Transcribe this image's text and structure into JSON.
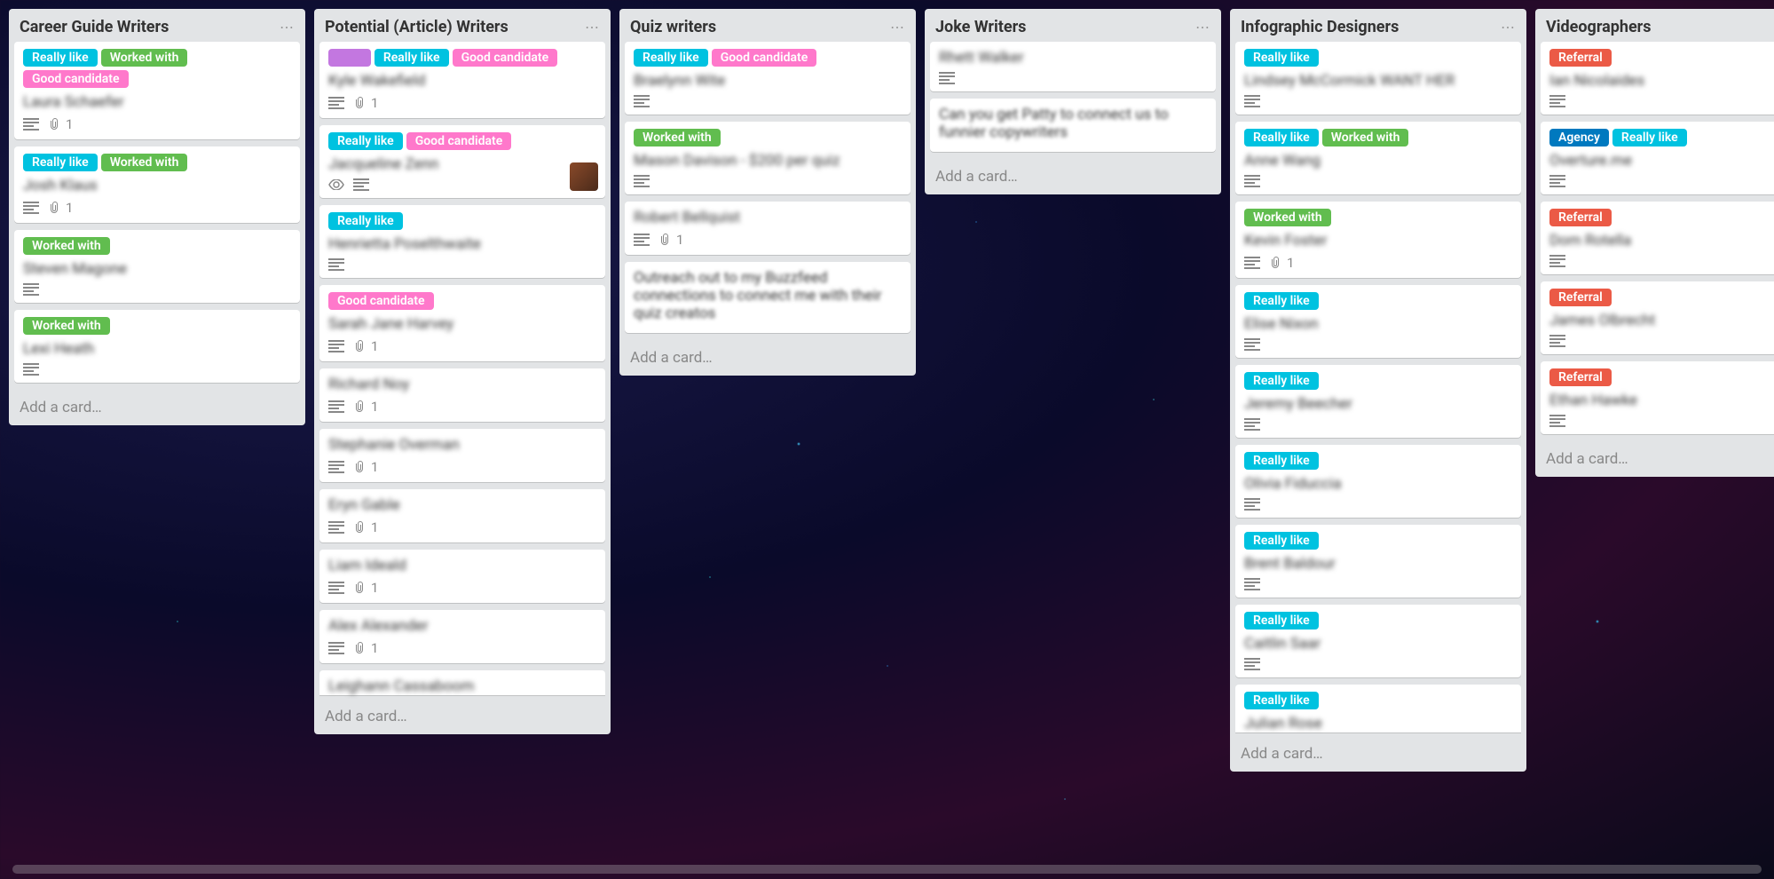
{
  "labels": {
    "really_like": "Really like",
    "worked_with": "Worked with",
    "good_candidate": "Good candidate",
    "referral": "Referral",
    "agency": "Agency"
  },
  "add_card": "Add a card…",
  "lists": [
    {
      "title": "Career Guide Writers",
      "cards": [
        {
          "labels": [
            [
              "cyan",
              "really_like"
            ],
            [
              "green",
              "worked_with"
            ],
            [
              "pink",
              "good_candidate"
            ]
          ],
          "title": "Laura Schaefer",
          "desc": true,
          "attach": "1"
        },
        {
          "labels": [
            [
              "cyan",
              "really_like"
            ],
            [
              "green",
              "worked_with"
            ]
          ],
          "title": "Josh Klaus",
          "desc": true,
          "attach": "1"
        },
        {
          "labels": [
            [
              "green",
              "worked_with"
            ]
          ],
          "title": "Steven Magone",
          "desc": true
        },
        {
          "labels": [
            [
              "green",
              "worked_with"
            ]
          ],
          "title": "Lexi Heath",
          "desc": true
        }
      ]
    },
    {
      "title": "Potential (Article) Writers",
      "cards": [
        {
          "labels": [
            [
              "purple",
              ""
            ],
            [
              "cyan",
              "really_like"
            ],
            [
              "pink",
              "good_candidate"
            ]
          ],
          "title": "Kyle Wakefield",
          "desc": true,
          "attach": "1"
        },
        {
          "labels": [
            [
              "cyan",
              "really_like"
            ],
            [
              "pink",
              "good_candidate"
            ]
          ],
          "title": "Jacqueline Zenn",
          "watch": true,
          "desc": true,
          "avatar": true
        },
        {
          "labels": [
            [
              "cyan",
              "really_like"
            ]
          ],
          "title": "Henrietta Poselthwaite",
          "desc": true
        },
        {
          "labels": [
            [
              "pink",
              "good_candidate"
            ]
          ],
          "title": "Sarah Jane Harvey",
          "desc": true,
          "attach": "1"
        },
        {
          "labels": [],
          "title": "Richard Noy",
          "desc": true,
          "attach": "1"
        },
        {
          "labels": [],
          "title": "Stephanie Overman",
          "desc": true,
          "attach": "1"
        },
        {
          "labels": [],
          "title": "Eryn Gable",
          "desc": true,
          "attach": "1"
        },
        {
          "labels": [],
          "title": "Liam Ideald",
          "desc": true,
          "attach": "1"
        },
        {
          "labels": [],
          "title": "Alex Alexander",
          "desc": true,
          "attach": "1"
        },
        {
          "labels": [],
          "title": "Leighann Cassaboom",
          "cut": true
        }
      ]
    },
    {
      "title": "Quiz writers",
      "cards": [
        {
          "labels": [
            [
              "cyan",
              "really_like"
            ],
            [
              "pink",
              "good_candidate"
            ]
          ],
          "title": "Braelynn Wite",
          "desc": true
        },
        {
          "labels": [
            [
              "green",
              "worked_with"
            ]
          ],
          "title": "Mason Davison - $200 per quiz",
          "desc": true
        },
        {
          "labels": [],
          "title": "Robert Bellquist",
          "desc": true,
          "attach": "1"
        },
        {
          "labels": [],
          "title_noblur": "Outreach out to my Buzzfeed connections to connect me with their quiz creatos"
        }
      ]
    },
    {
      "title": "Joke Writers",
      "cards": [
        {
          "labels": [],
          "title": "Rhett Walker",
          "desc": true
        },
        {
          "labels": [],
          "title_noblur": "Can you get Patty to connect us to funnier copywriters"
        }
      ]
    },
    {
      "title": "Infographic Designers",
      "cards": [
        {
          "labels": [
            [
              "cyan",
              "really_like"
            ]
          ],
          "title": "Lindsey McCormick WANT HER",
          "desc": true
        },
        {
          "labels": [
            [
              "cyan",
              "really_like"
            ],
            [
              "green",
              "worked_with"
            ]
          ],
          "title": "Anne Wang",
          "desc": true
        },
        {
          "labels": [
            [
              "green",
              "worked_with"
            ]
          ],
          "title": "Kevin Foster",
          "desc": true,
          "attach": "1"
        },
        {
          "labels": [
            [
              "cyan",
              "really_like"
            ]
          ],
          "title": "Elise Nixon",
          "desc": true
        },
        {
          "labels": [
            [
              "cyan",
              "really_like"
            ]
          ],
          "title": "Jeremy Beecher",
          "desc": true
        },
        {
          "labels": [
            [
              "cyan",
              "really_like"
            ]
          ],
          "title": "Olivia Fiduccia",
          "desc": true
        },
        {
          "labels": [
            [
              "cyan",
              "really_like"
            ]
          ],
          "title": "Brent Baldour",
          "desc": true
        },
        {
          "labels": [
            [
              "cyan",
              "really_like"
            ]
          ],
          "title": "Caitlin Saar",
          "desc": true
        },
        {
          "labels": [
            [
              "cyan",
              "really_like"
            ]
          ],
          "title": "Julian Rose",
          "cut": true
        }
      ]
    },
    {
      "title": "Videographers",
      "cards": [
        {
          "labels": [
            [
              "red",
              "referral"
            ]
          ],
          "title": "Ian Nicolaides",
          "desc": true
        },
        {
          "labels": [
            [
              "blue",
              "agency"
            ],
            [
              "cyan",
              "really_like"
            ]
          ],
          "title": "Overture.me",
          "desc": true
        },
        {
          "labels": [
            [
              "red",
              "referral"
            ]
          ],
          "title": "Dom Rotella",
          "desc": true
        },
        {
          "labels": [
            [
              "red",
              "referral"
            ]
          ],
          "title": "James Olbrecht",
          "desc": true
        },
        {
          "labels": [
            [
              "red",
              "referral"
            ]
          ],
          "title": "Ethan Hawke",
          "desc": true
        }
      ]
    }
  ]
}
